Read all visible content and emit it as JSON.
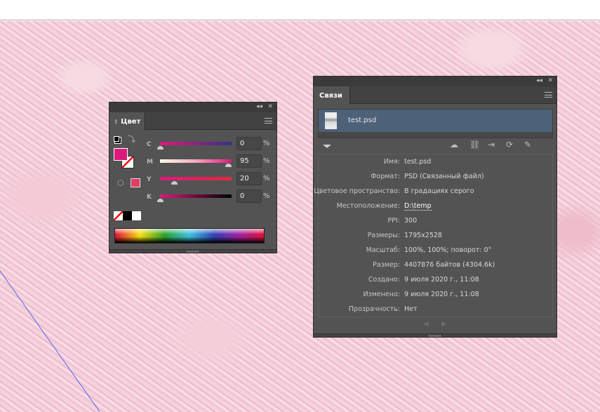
{
  "color_panel": {
    "tab": "Цвет",
    "channels": [
      {
        "label": "C",
        "value": "0",
        "fraction": 0
      },
      {
        "label": "M",
        "value": "95",
        "fraction": 0.95
      },
      {
        "label": "Y",
        "value": "20",
        "fraction": 0.2
      },
      {
        "label": "K",
        "value": "0",
        "fraction": 0
      }
    ],
    "percent": "%",
    "fill_color": "#dc1a7c",
    "swatch_color": "#e03c66"
  },
  "links_panel": {
    "tab": "Связи",
    "link_name": "test.psd",
    "info": [
      {
        "key": "Имя:",
        "value": "test.psd"
      },
      {
        "key": "Формат:",
        "value": "PSD (Связанный файл)"
      },
      {
        "key": "Цветовое пространство:",
        "value": "В градациях серого"
      },
      {
        "key": "Местоположение:",
        "value": "D:\\temp"
      },
      {
        "key": "PPI:",
        "value": "300"
      },
      {
        "key": "Размеры:",
        "value": "1795x2528"
      },
      {
        "key": "Масштаб:",
        "value": "100%, 100%; поворот: 0°"
      },
      {
        "key": "Размер:",
        "value": "4407876 байтов (4304.6k)"
      },
      {
        "key": "Создано:",
        "value": "9 июля 2020 г., 11:08"
      },
      {
        "key": "Изменено:",
        "value": "9 июля 2020 г., 11:08"
      },
      {
        "key": "Прозрачность:",
        "value": "Нет"
      }
    ]
  }
}
